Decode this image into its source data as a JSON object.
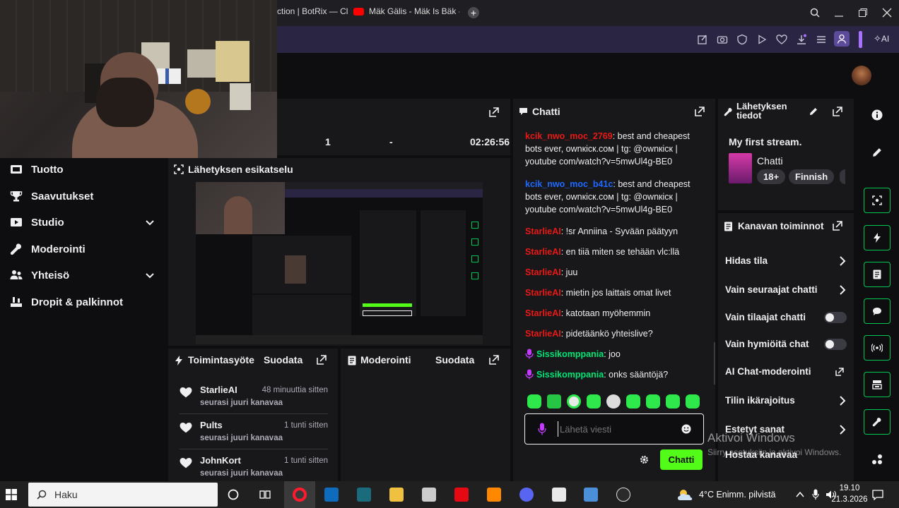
{
  "browser": {
    "tab1": "ction | BotRix — Clo",
    "tab2": "Mäk Gälis - Mäk Is Bäk - Y",
    "new_tab": "+",
    "ai_label": "AI"
  },
  "nav": {
    "items": [
      {
        "label": "Tuotto"
      },
      {
        "label": "Saavutukset"
      },
      {
        "label": "Studio"
      },
      {
        "label": "Moderointi"
      },
      {
        "label": "Yhteisö"
      },
      {
        "label": "Dropit & palkinnot"
      }
    ]
  },
  "stats": {
    "v1": "1",
    "v2": "-",
    "uptime": "02:26:56"
  },
  "preview": {
    "title": "Lähetyksen esikatselu"
  },
  "chat": {
    "title": "Chatti",
    "messages": [
      {
        "user": "kcik_nwo_moc_2769",
        "text": "best and cheapest bots ever, оwnкicк.coм | tg: @оwnкicк | youtube com/watch?v=5mwUl4g-BE0",
        "color": "#e91916"
      },
      {
        "user": "kcik_nwo_moc_b41c",
        "text": "best and cheapest bots ever, оwnкicк.coм | tg: @оwnкicк | youtube com/watch?v=5mwUl4g-BE0",
        "color": "#1e69ff"
      },
      {
        "user": "StarlieAI",
        "text": "!sr Anniina - Syvään päätyyn",
        "color": "#e91916"
      },
      {
        "user": "StarlieAI",
        "text": "en tiiä miten se tehään vlc:llä",
        "color": "#e91916"
      },
      {
        "user": "StarlieAI",
        "text": "juu",
        "color": "#e91916"
      },
      {
        "user": "StarlieAI",
        "text": "mietin jos laittais omat livet",
        "color": "#e91916"
      },
      {
        "user": "StarlieAI",
        "text": "katotaan myöhemmin",
        "color": "#e91916"
      },
      {
        "user": "StarlieAI",
        "text": "pidetäänkö yhteislive?",
        "color": "#e91916"
      },
      {
        "user": "Sissikomppania",
        "text": "joo",
        "color": "#00e676"
      },
      {
        "user": "Sissikomppania",
        "text": "onks sääntöjä?",
        "color": "#00e676"
      }
    ],
    "input_placeholder": "Lähetä viesti",
    "send_label": "Chatti",
    "sep": ": "
  },
  "stream_info": {
    "title": "Lähetyksen tiedot",
    "stream_title": "My first stream.",
    "category": "Chatti",
    "tags": [
      "18+",
      "Finnish"
    ]
  },
  "channel_actions": {
    "title": "Kanavan toiminnot",
    "items": [
      {
        "label": "Hidas tila"
      },
      {
        "label": "Vain seuraajat chatti"
      },
      {
        "label": "Vain tilaajat chatti"
      },
      {
        "label": "Vain hymiöitä chat"
      },
      {
        "label": "AI Chat-moderointi"
      },
      {
        "label": "Tilin ikärajoitus"
      },
      {
        "label": "Estetyt sanat"
      },
      {
        "label": "Hostaa kanavaa"
      }
    ]
  },
  "activity": {
    "title": "Toimintasyöte",
    "filter": "Suodata",
    "items": [
      {
        "name": "StarlieAI",
        "time": "48 minuuttia sitten",
        "action": "seurasi juuri kanavaa"
      },
      {
        "name": "Pults",
        "time": "1 tunti sitten",
        "action": "seurasi juuri kanavaa"
      },
      {
        "name": "JohnKort",
        "time": "1 tunti sitten",
        "action": "seurasi juuri kanavaa"
      }
    ]
  },
  "moderation": {
    "title": "Moderointi",
    "filter": "Suodata"
  },
  "watermark": {
    "line1": "Aktivoi Windows",
    "line2": "Siirry asetuksiin ja aktivoi Windows."
  },
  "taskbar": {
    "search": "Haku",
    "weather": "4°C  Enimm. pilvistä",
    "time": "19.10",
    "date": "21.3.2026"
  },
  "colors": {
    "accent": "#53fc18",
    "brand": "#2a2543",
    "mod_green": "#00c853"
  }
}
